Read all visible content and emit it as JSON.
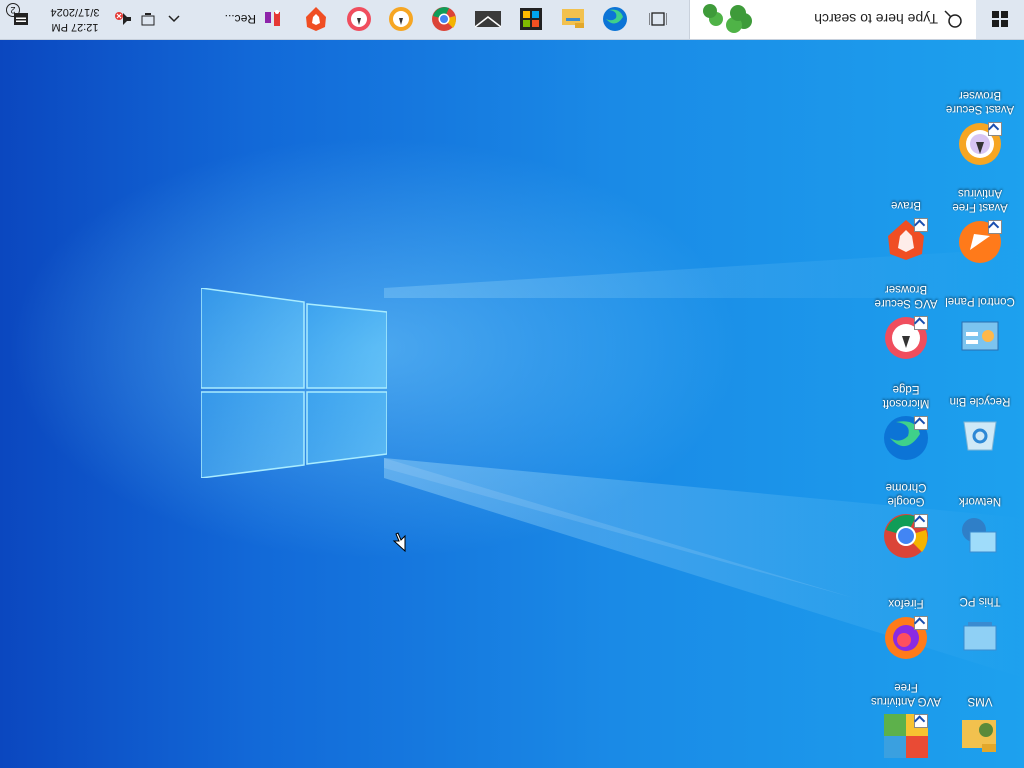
{
  "desktop": {
    "icons": [
      {
        "label": "VMS",
        "icon": "folder-icon"
      },
      {
        "label": "This PC",
        "icon": "this-pc-icon"
      },
      {
        "label": "Network",
        "icon": "network-icon"
      },
      {
        "label": "Recycle Bin",
        "icon": "recycle-bin-icon"
      },
      {
        "label": "Control Panel",
        "icon": "control-panel-icon"
      },
      {
        "label": "Avast Free Antivirus",
        "icon": "avast-icon"
      },
      {
        "label": "Avast Secure Browser",
        "icon": "avast-browser-icon"
      },
      {
        "label": "AVG Antivirus Free",
        "icon": "avg-antivirus-icon"
      },
      {
        "label": "Firefox",
        "icon": "firefox-icon"
      },
      {
        "label": "Google Chrome",
        "icon": "chrome-icon"
      },
      {
        "label": "Microsoft Edge",
        "icon": "edge-icon"
      },
      {
        "label": "AVG Secure Browser",
        "icon": "avg-browser-icon"
      },
      {
        "label": "Brave",
        "icon": "brave-icon"
      }
    ]
  },
  "taskbar": {
    "search_placeholder": "Type here to search",
    "pinned": [
      "task-view-icon",
      "edge-icon",
      "file-explorer-icon",
      "store-icon",
      "mail-icon",
      "chrome-icon",
      "avast-browser-icon",
      "avg-browser-icon",
      "brave-icon"
    ],
    "running_app_label": "Rec...",
    "clock_time": "12:27 PM",
    "clock_date": "3/17/2024",
    "notification_count": "2"
  },
  "colors": {
    "wallpaper_light": "#1da1ee",
    "wallpaper_dark": "#0b47bf",
    "taskbar": "#dfe7f1"
  }
}
